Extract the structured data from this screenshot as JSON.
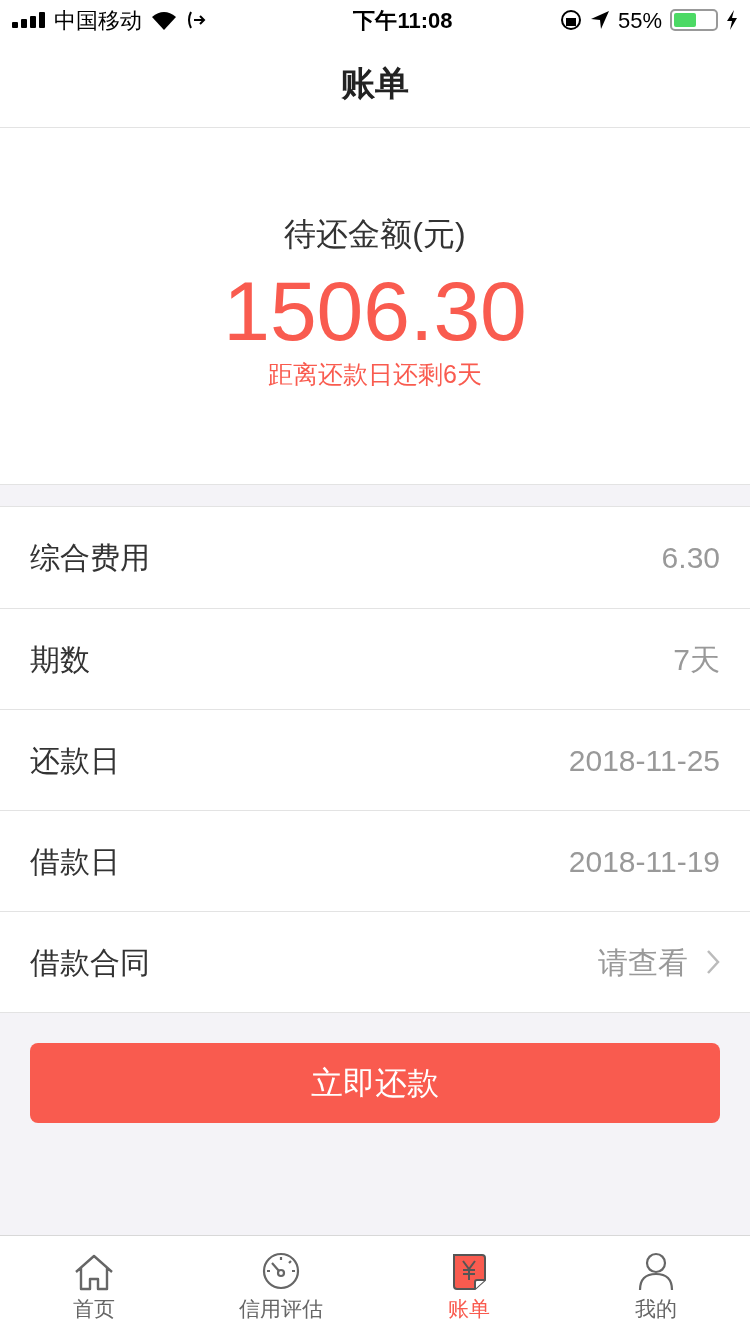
{
  "status_bar": {
    "carrier": "中国移动",
    "time": "下午11:08",
    "battery_percent": "55%",
    "battery": {
      "level": 0.55
    }
  },
  "nav": {
    "title": "账单"
  },
  "summary": {
    "label": "待还金额(元)",
    "amount": "1506.30",
    "note": "距离还款日还剩6天"
  },
  "rows": [
    {
      "kind": "value",
      "label": "综合费用",
      "value": "6.30"
    },
    {
      "kind": "value",
      "label": "期数",
      "value": "7天"
    },
    {
      "kind": "value",
      "label": "还款日",
      "value": "2018-11-25"
    },
    {
      "kind": "value",
      "label": "借款日",
      "value": "2018-11-19"
    },
    {
      "kind": "link",
      "label": "借款合同",
      "value": "请查看"
    }
  ],
  "action_button": "立即还款",
  "tabs": [
    {
      "kind": "home",
      "label": "首页",
      "selected": false
    },
    {
      "kind": "gauge",
      "label": "信用评估",
      "selected": false
    },
    {
      "kind": "bill",
      "label": "账单",
      "selected": true
    },
    {
      "kind": "user",
      "label": "我的",
      "selected": false
    }
  ]
}
